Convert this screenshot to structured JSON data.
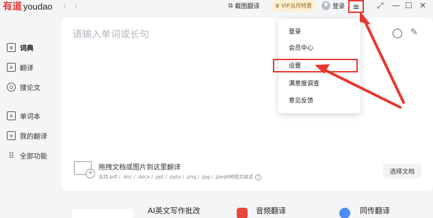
{
  "app": {
    "logo_mark": "有道",
    "logo_word": "youdao"
  },
  "titlebar": {
    "back_arrow": "‹",
    "forward_arrow": "›",
    "screenshot_label": "截图翻译",
    "vip_label": "VIP当月特惠",
    "login_label": "登录",
    "menu_glyph": "≡",
    "win_pin": "⤢",
    "win_min": "—",
    "win_max": "☐",
    "win_close": "✕"
  },
  "sidebar": {
    "items": [
      {
        "label": "词典",
        "icon": "dictionary-icon",
        "glyph": "≡",
        "active": true
      },
      {
        "label": "翻译",
        "icon": "translate-icon",
        "glyph": "A"
      },
      {
        "label": "搜论文",
        "icon": "paper-search-icon",
        "glyph": "Q"
      },
      {
        "label": "单词本",
        "icon": "wordbook-icon",
        "glyph": "A"
      },
      {
        "label": "我的翻译",
        "icon": "my-translation-icon",
        "glyph": "≡"
      },
      {
        "label": "全部功能",
        "icon": "all-features-icon",
        "glyph": "⠿"
      }
    ]
  },
  "main": {
    "search_placeholder": "请输入单词或长句",
    "upload_title": "拖拽文档或图片到这里翻译",
    "upload_formats": "支持.pdf / .doc / .docx / .ppt / .pptx / .png / .jpg / .jpeg8种图文格式",
    "select_button": "选择文档",
    "help_glyph": "?"
  },
  "bottom_cards": [
    {
      "label": "AI英文写作批改",
      "icon": "ai-writing-icon"
    },
    {
      "label": "音频翻译",
      "icon": "audio-translate-icon",
      "color": "#e8473c"
    },
    {
      "label": "同传翻译",
      "icon": "simultaneous-translate-icon",
      "color": "#4c8ef7"
    }
  ],
  "menu": {
    "items": [
      "登录",
      "会员中心",
      "设置",
      "满意度调查",
      "意见反馈"
    ],
    "highlighted": "设置"
  },
  "colors": {
    "accent_red": "#e8382f",
    "vip_bg": "#fcefd4"
  }
}
